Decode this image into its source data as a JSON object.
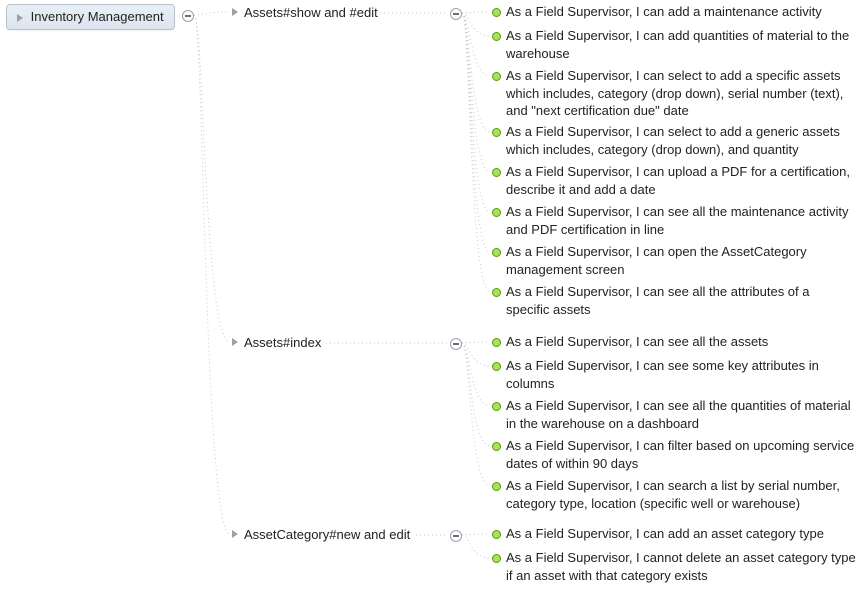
{
  "root": {
    "label": "Inventory Management"
  },
  "branches": [
    {
      "id": "b0",
      "label": "Assets#show and #edit",
      "leaves": [
        "As a Field Supervisor, I can add a maintenance activity",
        "As a Field Supervisor, I can add quantities of material to the warehouse",
        "As a Field Supervisor, I can select to add a specific assets which includes, category (drop down), serial number (text), and \"next certification due\" date",
        "As a Field Supervisor, I can select to add a generic assets which includes, category (drop down), and quantity",
        "As a Field Supervisor, I can upload a PDF for a certification, describe it and add a date",
        "As a Field Supervisor, I can see all the maintenance activity and PDF certification in line",
        "As a Field Supervisor, I can open the AssetCategory management screen",
        "As a Field Supervisor, I can see all the attributes of a specific assets"
      ]
    },
    {
      "id": "b1",
      "label": "Assets#index",
      "leaves": [
        "As a Field Supervisor, I can see all the assets",
        "As a Field Supervisor, I can see some key attributes in columns",
        "As a Field Supervisor, I can see all the quantities of material in the warehouse on a dashboard",
        "As a Field Supervisor, I can filter based on upcoming service dates of within 90 days",
        "As a Field Supervisor, I can search a list by serial number, category type, location (specific well or warehouse)"
      ]
    },
    {
      "id": "b2",
      "label": "AssetCategory#new and edit",
      "leaves": [
        "As a Field Supervisor, I can add an asset category type",
        "As a Field Supervisor, I cannot delete an asset category type if an asset with that category exists"
      ]
    }
  ],
  "colors": {
    "connector": "#c5c8cd",
    "leaf_dot": "#a8e060"
  }
}
